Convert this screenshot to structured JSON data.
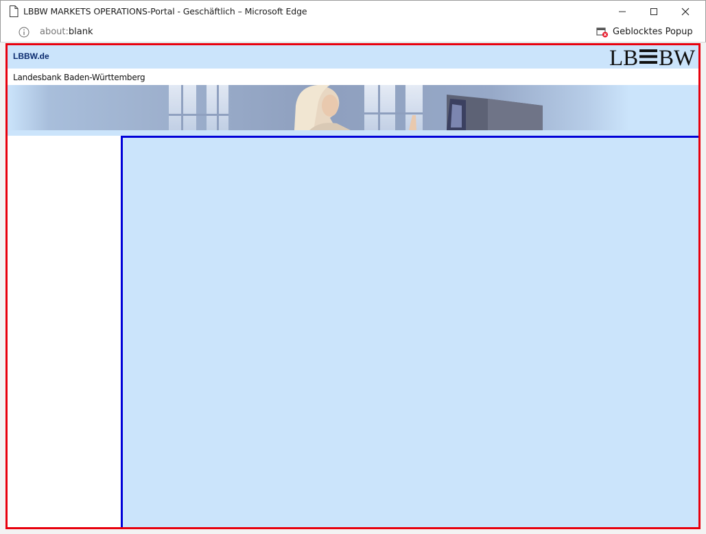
{
  "window": {
    "title": "LBBW MARKETS OPERATIONS-Portal - Geschäftlich – Microsoft Edge"
  },
  "address_bar": {
    "url_scheme": "about:",
    "url_host": "blank",
    "blocked_popup_label": "Geblocktes Popup"
  },
  "page": {
    "site_link": "LBBW.de",
    "bank_name": "Landesbank Baden-Württemberg",
    "logo_text_left": "LB",
    "logo_text_right": "BW"
  },
  "colors": {
    "frame_border": "#e8000d",
    "content_border": "#0000d8",
    "light_blue": "#cbe4fb",
    "link_blue": "#0a2a6e"
  }
}
